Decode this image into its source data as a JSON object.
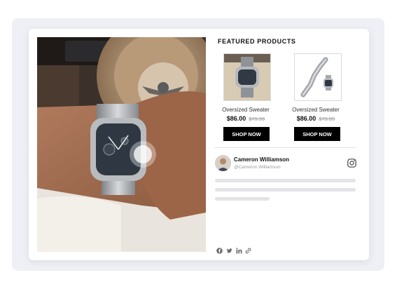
{
  "featured": {
    "title": "FEATURED PRODUCTS",
    "products": [
      {
        "name": "Oversized Sweater",
        "price": "$86.00",
        "old_price": "$79.99",
        "button": "SHOP NOW"
      },
      {
        "name": "Oversized Sweater",
        "price": "$86.00",
        "old_price": "$79.99",
        "button": "SHOP NOW"
      }
    ]
  },
  "author": {
    "name": "Cameron Williamson",
    "handle": "@Cameron Williamson"
  },
  "icons": {
    "social": "instagram-icon",
    "share": [
      "facebook-icon",
      "twitter-icon",
      "linkedin-icon",
      "link-icon"
    ]
  },
  "colors": {
    "button_bg": "#000000",
    "card_bg": "#ffffff",
    "frame_bg": "#eef0f5"
  }
}
